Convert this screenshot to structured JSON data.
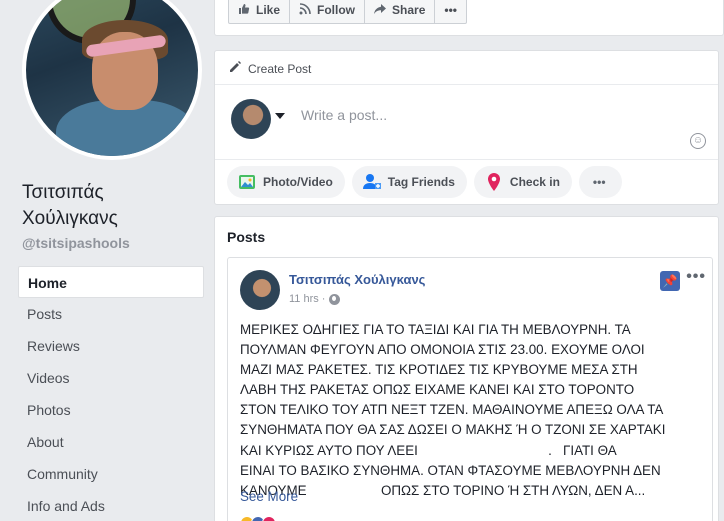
{
  "page": {
    "name": "Τσιτσιπάς Χούλιγκανς",
    "handle": "@tsitsipashools"
  },
  "sidebar": {
    "items": [
      {
        "label": "Home",
        "active": true
      },
      {
        "label": "Posts"
      },
      {
        "label": "Reviews"
      },
      {
        "label": "Videos"
      },
      {
        "label": "Photos"
      },
      {
        "label": "About"
      },
      {
        "label": "Community"
      },
      {
        "label": "Info and Ads"
      }
    ]
  },
  "action_bar": {
    "like_label": "Like",
    "follow_label": "Follow",
    "share_label": "Share",
    "more_label": "•••"
  },
  "create_post": {
    "title": "Create Post",
    "placeholder": "Write a post...",
    "buttons": {
      "photo_video": "Photo/Video",
      "tag_friends": "Tag Friends",
      "check_in": "Check in",
      "more": "•••"
    }
  },
  "posts": {
    "title": "Posts",
    "items": [
      {
        "author": "Τσιτσιπάς Χούλιγκανς",
        "time": "11 hrs ·",
        "text_lines": [
          "ΜΕΡΙΚΕΣ ΟΔΗΓΙΕΣ ΓΙΑ ΤΟ ΤΑΞΙΔΙ ΚΑΙ ΓΙΑ ΤΗ ΜΕΒΛΟΥΡΝΗ. ΤΑ",
          "ΠΟΥΛΜΑΝ ΦΕΥΓΟΥΝ ΑΠΟ ΟΜΟΝΟΙΑ ΣΤΙΣ 23.00. ΕΧΟΥΜΕ ΟΛΟΙ",
          "ΜΑΖΙ ΜΑΣ ΡΑΚΕΤΕΣ. ΤΙΣ ΚΡΟΤΙΔΕΣ ΤΙΣ ΚΡΥΒΟΥΜΕ ΜΕΣΑ ΣΤΗ",
          "ΛΑΒΗ ΤΗΣ ΡΑΚΕΤΑΣ ΟΠΩΣ ΕΙΧΑΜΕ ΚΑΝΕΙ ΚΑΙ ΣΤΟ ΤΟΡΟΝΤΟ",
          "ΣΤΟΝ ΤΕΛΙΚΟ ΤΟΥ ΑΤΠ ΝΕΞΤ ΤΖΕΝ. ΜΑΘΑΙΝΟΥΜΕ ΑΠΕΞΩ ΟΛΑ ΤΑ",
          "ΣΥΝΘΗΜΑΤΑ ΠΟΥ ΘΑ ΣΑΣ ΔΩΣΕΙ Ο ΜΑΚΗΣ Ή Ο ΤΖΟΝΙ ΣΕ ΧΑΡΤΑΚΙ",
          "ΚΑΙ ΚΥΡΙΩΣ ΑΥΤΟ ΠΟΥ ΛΕΕΙ                                   .   ΓΙΑΤΙ ΘΑ",
          "ΕΙΝΑΙ ΤΟ ΒΑΣΙΚΟ ΣΥΝΘΗΜΑ. ΟΤΑΝ ΦΤΑΣΟΥΜΕ ΜΕΒΛΟΥΡΝΗ ΔΕΝ",
          "ΚΑΝΟΥΜΕ                    ΟΠΩΣ ΣΤΟ ΤΟΡΙΝΟ Ή ΣΤΗ ΛΥΩΝ, ΔΕΝ Α..."
        ],
        "see_more": "See More"
      }
    ]
  },
  "colors": {
    "brand": "#4267b2",
    "link": "#365899",
    "background": "#e9ebee"
  }
}
